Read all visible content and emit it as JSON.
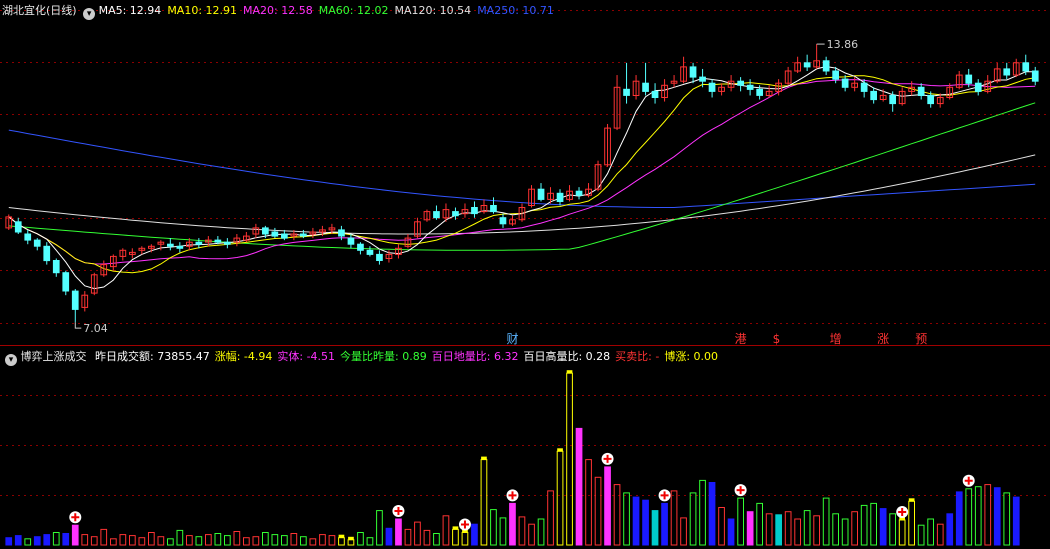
{
  "main": {
    "title": "湖北宜化(日线)",
    "ma_labels": [
      {
        "text": "MA5: 12.94",
        "color": "#ffffff"
      },
      {
        "text": "MA10: 12.91",
        "color": "#ffff00"
      },
      {
        "text": "MA20: 12.58",
        "color": "#ff33ff"
      },
      {
        "text": "MA60: 12.02",
        "color": "#33ff33"
      },
      {
        "text": "MA120: 10.54",
        "color": "#e0e0e0"
      },
      {
        "text": "MA250: 10.71",
        "color": "#3355ff"
      }
    ],
    "high_label": "13.86",
    "low_label": "7.04",
    "event_markers": [
      {
        "text": "财",
        "color": "#5ab4ff"
      },
      {
        "text": "港",
        "color": "#ff3333"
      },
      {
        "text": "$",
        "color": "#ff3333"
      },
      {
        "text": "增",
        "color": "#ff3333"
      },
      {
        "text": "涨",
        "color": "#ff3333"
      },
      {
        "text": "预",
        "color": "#ff3333"
      }
    ]
  },
  "volume": {
    "indicator_name": "博弈上涨成交",
    "stats": [
      {
        "text": "昨日成交额: 73855.47",
        "color": "#ffffff"
      },
      {
        "text": "涨幅: -4.94",
        "color": "#ffff00"
      },
      {
        "text": "实体: -4.51",
        "color": "#ff33ff"
      },
      {
        "text": "今量比昨量: 0.89",
        "color": "#33ff33"
      },
      {
        "text": "百日地量比: 6.32",
        "color": "#ff33ff"
      },
      {
        "text": "百日高量比: 0.28",
        "color": "#ffffff"
      },
      {
        "text": "买卖比: -",
        "color": "#ff3333"
      },
      {
        "text": "博涨: 0.00",
        "color": "#ffff00"
      }
    ]
  },
  "colors": {
    "up": "#ff3333",
    "down": "#54ffff",
    "grid": "#8b0000",
    "ma5": "#ffffff",
    "ma10": "#ffff00",
    "ma20": "#ff33ff",
    "ma60": "#33ff33",
    "ma120": "#e0e0e0",
    "ma250": "#3355ff",
    "vol_blue": "#1a1aff",
    "vol_magenta": "#ff33ff",
    "vol_green": "#33ff33",
    "vol_yellow": "#ffff00",
    "vol_teal": "#00cccc"
  },
  "chart_data": {
    "type": "candlestick",
    "price_range": [
      6.6,
      14.5
    ],
    "candles": [
      [
        9.35,
        9.62,
        9.68,
        9.3
      ],
      [
        9.5,
        9.25,
        9.6,
        9.2
      ],
      [
        9.2,
        9.05,
        9.3,
        8.95
      ],
      [
        9.05,
        8.9,
        9.1,
        8.8
      ],
      [
        8.9,
        8.55,
        9.0,
        8.45
      ],
      [
        8.55,
        8.25,
        8.6,
        8.15
      ],
      [
        8.25,
        7.8,
        8.3,
        7.7
      ],
      [
        7.8,
        7.35,
        7.85,
        7.04
      ],
      [
        7.4,
        7.7,
        7.8,
        7.3
      ],
      [
        7.75,
        8.2,
        8.25,
        7.7
      ],
      [
        8.2,
        8.45,
        8.55,
        8.15
      ],
      [
        8.4,
        8.65,
        8.7,
        8.3
      ],
      [
        8.65,
        8.8,
        8.85,
        8.55
      ],
      [
        8.7,
        8.75,
        8.85,
        8.6
      ],
      [
        8.8,
        8.85,
        8.9,
        8.7
      ],
      [
        8.85,
        8.9,
        8.95,
        8.75
      ],
      [
        8.95,
        9.0,
        9.05,
        8.8
      ],
      [
        8.95,
        8.9,
        9.1,
        8.8
      ],
      [
        8.9,
        8.85,
        9.0,
        8.75
      ],
      [
        8.9,
        9.0,
        9.1,
        8.8
      ],
      [
        9.0,
        8.95,
        9.1,
        8.85
      ],
      [
        9.0,
        9.05,
        9.15,
        8.9
      ],
      [
        9.05,
        9.0,
        9.15,
        8.95
      ],
      [
        9.0,
        8.95,
        9.1,
        8.85
      ],
      [
        9.0,
        9.1,
        9.2,
        8.9
      ],
      [
        9.05,
        9.15,
        9.25,
        9.0
      ],
      [
        9.2,
        9.35,
        9.45,
        9.1
      ],
      [
        9.35,
        9.2,
        9.4,
        9.1
      ],
      [
        9.25,
        9.15,
        9.35,
        9.1
      ],
      [
        9.2,
        9.1,
        9.3,
        9.05
      ],
      [
        9.15,
        9.2,
        9.3,
        9.05
      ],
      [
        9.2,
        9.15,
        9.3,
        9.1
      ],
      [
        9.2,
        9.25,
        9.35,
        9.1
      ],
      [
        9.25,
        9.3,
        9.4,
        9.15
      ],
      [
        9.3,
        9.35,
        9.45,
        9.2
      ],
      [
        9.3,
        9.15,
        9.4,
        9.05
      ],
      [
        9.1,
        8.95,
        9.2,
        8.85
      ],
      [
        8.95,
        8.8,
        9.0,
        8.7
      ],
      [
        8.8,
        8.7,
        8.9,
        8.65
      ],
      [
        8.7,
        8.55,
        8.8,
        8.45
      ],
      [
        8.6,
        8.7,
        8.8,
        8.5
      ],
      [
        8.7,
        8.85,
        8.95,
        8.6
      ],
      [
        8.9,
        9.1,
        9.2,
        8.85
      ],
      [
        9.15,
        9.5,
        9.6,
        9.1
      ],
      [
        9.55,
        9.75,
        9.8,
        9.5
      ],
      [
        9.75,
        9.6,
        9.9,
        9.55
      ],
      [
        9.6,
        9.8,
        9.95,
        9.5
      ],
      [
        9.75,
        9.65,
        9.85,
        9.55
      ],
      [
        9.7,
        9.8,
        9.95,
        9.6
      ],
      [
        9.85,
        9.7,
        10.0,
        9.6
      ],
      [
        9.75,
        9.9,
        10.05,
        9.7
      ],
      [
        9.9,
        9.75,
        10.1,
        9.7
      ],
      [
        9.6,
        9.45,
        9.7,
        9.35
      ],
      [
        9.45,
        9.55,
        9.65,
        9.4
      ],
      [
        9.55,
        9.85,
        9.95,
        9.5
      ],
      [
        9.9,
        10.3,
        10.4,
        9.85
      ],
      [
        10.3,
        10.05,
        10.45,
        10.0
      ],
      [
        10.05,
        10.2,
        10.35,
        9.95
      ],
      [
        10.2,
        10.0,
        10.3,
        9.9
      ],
      [
        10.05,
        10.25,
        10.4,
        10.0
      ],
      [
        10.25,
        10.15,
        10.35,
        10.05
      ],
      [
        10.15,
        10.3,
        10.45,
        10.1
      ],
      [
        10.3,
        10.9,
        11.0,
        10.25
      ],
      [
        10.9,
        11.8,
        11.9,
        10.85
      ],
      [
        11.8,
        12.8,
        13.1,
        11.75
      ],
      [
        12.75,
        12.6,
        13.4,
        12.4
      ],
      [
        12.6,
        12.95,
        13.1,
        12.5
      ],
      [
        12.9,
        12.7,
        13.4,
        12.6
      ],
      [
        12.7,
        12.55,
        12.9,
        12.4
      ],
      [
        12.55,
        12.85,
        13.0,
        12.45
      ],
      [
        12.9,
        12.95,
        13.1,
        12.8
      ],
      [
        12.95,
        13.3,
        13.55,
        12.9
      ],
      [
        13.3,
        13.05,
        13.4,
        12.9
      ],
      [
        13.05,
        12.95,
        13.25,
        12.8
      ],
      [
        12.9,
        12.7,
        13.0,
        12.55
      ],
      [
        12.7,
        12.8,
        12.9,
        12.6
      ],
      [
        12.8,
        12.95,
        13.1,
        12.7
      ],
      [
        12.95,
        12.85,
        13.05,
        12.7
      ],
      [
        12.85,
        12.75,
        13.0,
        12.6
      ],
      [
        12.75,
        12.6,
        12.85,
        12.5
      ],
      [
        12.6,
        12.7,
        12.85,
        12.55
      ],
      [
        12.7,
        12.9,
        13.0,
        12.6
      ],
      [
        12.9,
        13.2,
        13.3,
        12.85
      ],
      [
        13.2,
        13.4,
        13.55,
        13.15
      ],
      [
        13.4,
        13.3,
        13.6,
        13.2
      ],
      [
        13.3,
        13.45,
        13.86,
        13.25
      ],
      [
        13.45,
        13.2,
        13.55,
        13.1
      ],
      [
        13.2,
        13.0,
        13.3,
        12.9
      ],
      [
        13.0,
        12.8,
        13.1,
        12.7
      ],
      [
        12.8,
        12.9,
        13.05,
        12.7
      ],
      [
        12.9,
        12.7,
        13.0,
        12.55
      ],
      [
        12.7,
        12.5,
        12.8,
        12.4
      ],
      [
        12.5,
        12.6,
        12.75,
        12.45
      ],
      [
        12.6,
        12.4,
        12.7,
        12.2
      ],
      [
        12.4,
        12.7,
        12.8,
        12.35
      ],
      [
        12.7,
        12.8,
        12.95,
        12.6
      ],
      [
        12.8,
        12.6,
        12.9,
        12.5
      ],
      [
        12.6,
        12.4,
        12.7,
        12.3
      ],
      [
        12.4,
        12.55,
        12.65,
        12.3
      ],
      [
        12.55,
        12.8,
        12.9,
        12.5
      ],
      [
        12.8,
        13.1,
        13.2,
        12.75
      ],
      [
        13.1,
        12.9,
        13.25,
        12.8
      ],
      [
        12.9,
        12.7,
        13.0,
        12.6
      ],
      [
        12.7,
        12.95,
        13.1,
        12.65
      ],
      [
        12.95,
        13.25,
        13.4,
        12.9
      ],
      [
        13.25,
        13.1,
        13.4,
        13.0
      ],
      [
        13.1,
        13.4,
        13.5,
        13.05
      ],
      [
        13.4,
        13.2,
        13.6,
        13.1
      ],
      [
        13.2,
        12.95,
        13.3,
        12.85
      ]
    ],
    "volumes": [
      [
        0.7,
        "b"
      ],
      [
        0.9,
        "b"
      ],
      [
        0.6,
        "g"
      ],
      [
        0.8,
        "b"
      ],
      [
        1.0,
        "b"
      ],
      [
        1.2,
        "g"
      ],
      [
        1.1,
        "b"
      ],
      [
        1.9,
        "m"
      ],
      [
        1.0,
        "g"
      ],
      [
        0.8,
        "g"
      ],
      [
        1.5,
        "g"
      ],
      [
        0.6,
        "g"
      ],
      [
        1.0,
        "g"
      ],
      [
        0.9,
        "g"
      ],
      [
        0.7,
        "g"
      ],
      [
        1.2,
        "g"
      ],
      [
        0.8,
        "g"
      ],
      [
        0.6,
        "g"
      ],
      [
        1.4,
        "g"
      ],
      [
        0.9,
        "g"
      ],
      [
        0.8,
        "g"
      ],
      [
        1.0,
        "g"
      ],
      [
        1.1,
        "g"
      ],
      [
        0.9,
        "g"
      ],
      [
        1.3,
        "g"
      ],
      [
        0.7,
        "g"
      ],
      [
        0.8,
        "g"
      ],
      [
        1.2,
        "g"
      ],
      [
        1.0,
        "g"
      ],
      [
        0.9,
        "g"
      ],
      [
        1.1,
        "g"
      ],
      [
        0.8,
        "g"
      ],
      [
        0.6,
        "g"
      ],
      [
        1.0,
        "g"
      ],
      [
        0.9,
        "g"
      ],
      [
        0.7,
        "y"
      ],
      [
        0.5,
        "y"
      ],
      [
        1.2,
        "g"
      ],
      [
        0.7,
        "g"
      ],
      [
        3.3,
        "g"
      ],
      [
        1.6,
        "b"
      ],
      [
        2.5,
        "m"
      ],
      [
        1.5,
        "g"
      ],
      [
        2.2,
        "g"
      ],
      [
        1.4,
        "g"
      ],
      [
        1.1,
        "g"
      ],
      [
        2.8,
        "g"
      ],
      [
        1.5,
        "y"
      ],
      [
        1.2,
        "y"
      ],
      [
        2.0,
        "b"
      ],
      [
        8.2,
        "y"
      ],
      [
        3.4,
        "g"
      ],
      [
        2.6,
        "g"
      ],
      [
        4.0,
        "m"
      ],
      [
        2.7,
        "g"
      ],
      [
        2.0,
        "g"
      ],
      [
        2.5,
        "g"
      ],
      [
        5.2,
        "g"
      ],
      [
        9.0,
        "y"
      ],
      [
        16.5,
        "y"
      ],
      [
        11.2,
        "m"
      ],
      [
        8.2,
        "g"
      ],
      [
        6.5,
        "g"
      ],
      [
        7.5,
        "m"
      ],
      [
        5.8,
        "g"
      ],
      [
        5.0,
        "g"
      ],
      [
        4.6,
        "b"
      ],
      [
        4.3,
        "b"
      ],
      [
        3.3,
        "t"
      ],
      [
        4.0,
        "b"
      ],
      [
        5.2,
        "g"
      ],
      [
        2.6,
        "g"
      ],
      [
        5.0,
        "g"
      ],
      [
        6.2,
        "g"
      ],
      [
        6.0,
        "b"
      ],
      [
        3.6,
        "g"
      ],
      [
        2.5,
        "b"
      ],
      [
        4.5,
        "g"
      ],
      [
        3.2,
        "m"
      ],
      [
        4.0,
        "g"
      ],
      [
        3.0,
        "g"
      ],
      [
        2.9,
        "t"
      ],
      [
        3.2,
        "g"
      ],
      [
        2.5,
        "g"
      ],
      [
        3.3,
        "g"
      ],
      [
        2.8,
        "g"
      ],
      [
        4.5,
        "g"
      ],
      [
        3.0,
        "g"
      ],
      [
        2.5,
        "g"
      ],
      [
        3.2,
        "g"
      ],
      [
        3.8,
        "g"
      ],
      [
        4.0,
        "g"
      ],
      [
        3.5,
        "b"
      ],
      [
        3.0,
        "g"
      ],
      [
        2.4,
        "y"
      ],
      [
        4.2,
        "y"
      ],
      [
        1.9,
        "g"
      ],
      [
        2.5,
        "g"
      ],
      [
        2.0,
        "g"
      ],
      [
        3.0,
        "b"
      ],
      [
        5.1,
        "b"
      ],
      [
        5.4,
        "g"
      ],
      [
        5.6,
        "g"
      ],
      [
        5.8,
        "g"
      ],
      [
        5.5,
        "b"
      ],
      [
        5.0,
        "g"
      ],
      [
        4.6,
        "b"
      ]
    ],
    "markers": [
      {
        "kind": "plus",
        "bar": 7
      },
      {
        "kind": "plus",
        "bar": 41
      },
      {
        "kind": "plus",
        "bar": 48
      },
      {
        "kind": "plus",
        "bar": 53
      },
      {
        "kind": "plus",
        "bar": 63
      },
      {
        "kind": "plus",
        "bar": 69
      },
      {
        "kind": "plus",
        "bar": 77
      },
      {
        "kind": "plus",
        "bar": 94
      },
      {
        "kind": "plus",
        "bar": 101
      }
    ]
  }
}
